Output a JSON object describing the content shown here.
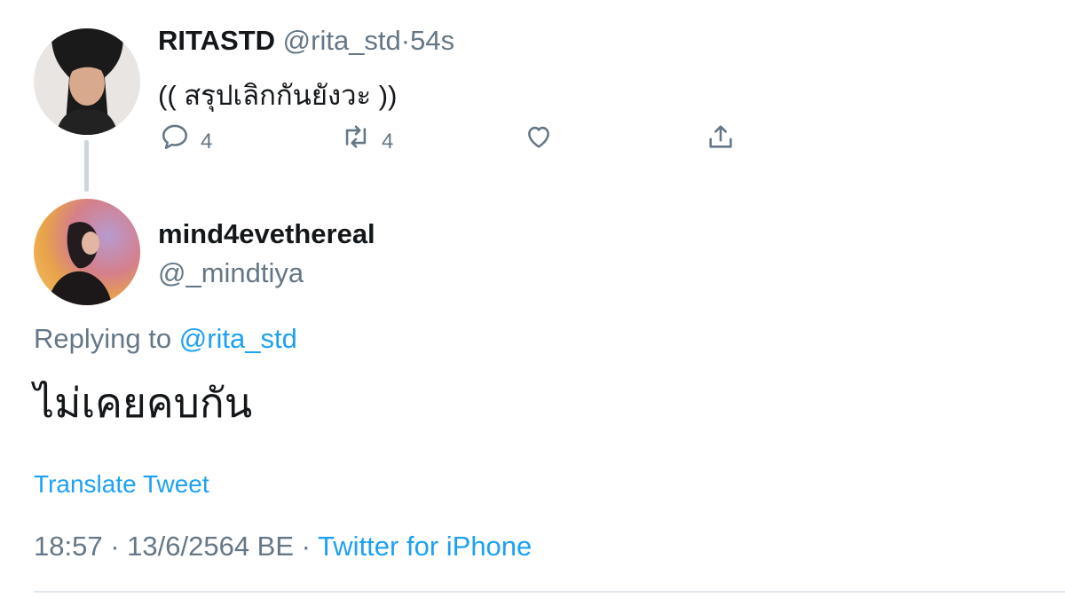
{
  "tweet1": {
    "display_name": "RITASTD",
    "handle": "@rita_std",
    "separator": "·",
    "time": "54s",
    "text": "(( สรุปเลิกกันยังวะ ))",
    "actions": {
      "reply_count": "4",
      "retweet_count": "4",
      "like_count": "",
      "icons": [
        "reply-icon",
        "retweet-icon",
        "like-icon",
        "share-icon"
      ]
    }
  },
  "tweet2": {
    "display_name": "mind4evethereal",
    "handle": "@_mindtiya",
    "replying_prefix": "Replying to",
    "replying_handle": "@rita_std",
    "text": "ไม่เคยคบกัน",
    "translate_label": "Translate Tweet",
    "time": "18:57",
    "dot1": "·",
    "date": "13/6/2564 BE",
    "dot2": "·",
    "source": "Twitter for iPhone"
  },
  "colors": {
    "link": "#1da1f2",
    "muted": "#657786",
    "text": "#14171a",
    "divider": "#e1e8ed"
  }
}
